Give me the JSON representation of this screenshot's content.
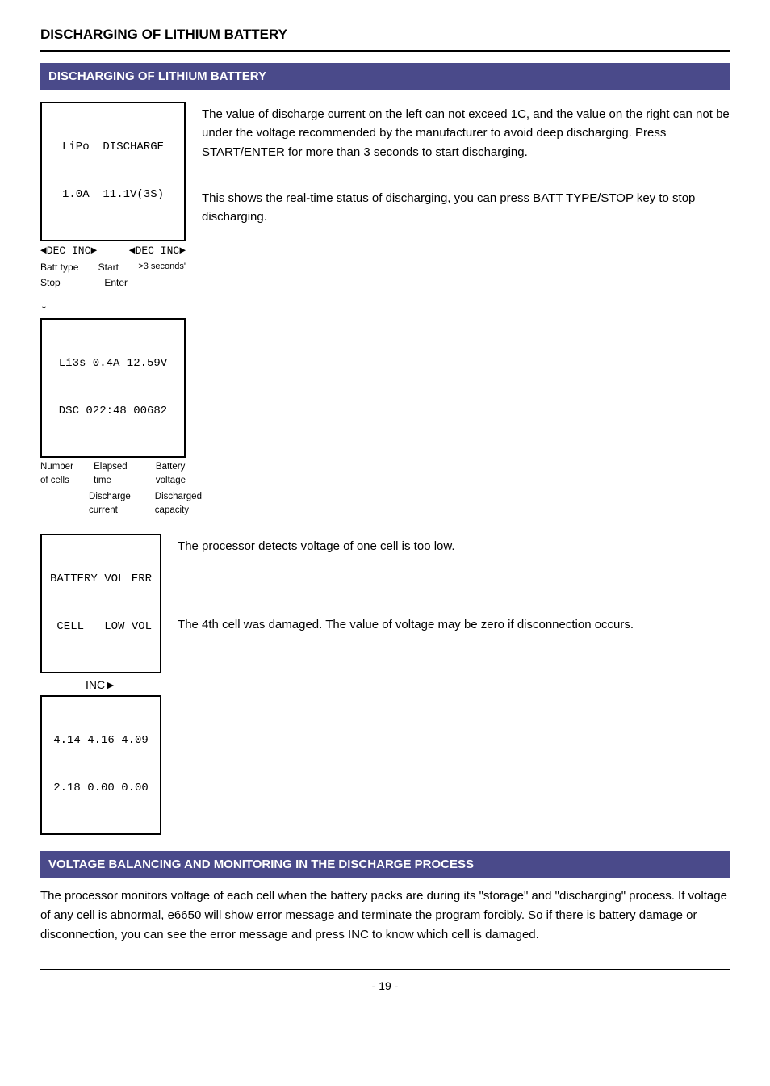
{
  "page": {
    "title": "DISCHARGING OF LITHIUM BATTERY",
    "section1_header": "DISCHARGING OF LITHIUM BATTERY",
    "section2_header": "VOLTAGE BALANCING AND MONITORING IN THE DISCHARGE PROCESS",
    "page_number": "- 19 -"
  },
  "discharge_screen1": {
    "line1": "LiPo  DISCHARGE",
    "line2": "1.0A  11.1V(3S)"
  },
  "discharge_screen1_buttons": {
    "left": "◄DEC INC►",
    "right": "◄DEC INC►"
  },
  "discharge_labels1": {
    "batt_type": "Batt type",
    "start": "Start",
    "stop": "Stop",
    "enter": "Enter",
    "time": ">3 seconds'"
  },
  "discharge_screen2": {
    "line1": "Li3s 0.4A 12.59V",
    "line2": "DSC 022:48 00682"
  },
  "discharge_labels2": {
    "number_of_cells": "Number",
    "of_cells": "of cells",
    "elapsed_time": "Elapsed",
    "time": "time",
    "battery_voltage": "Battery",
    "voltage": "voltage",
    "discharge_current": "Discharge",
    "current": "current",
    "discharged_capacity": "Discharged",
    "capacity": "capacity"
  },
  "desc1": "The value of discharge current on the left can not exceed 1C, and the value on the right can not be under the voltage recommended by the manufacturer to avoid deep discharging. Press START/ENTER for more than 3 seconds to start discharging.",
  "desc2": "This shows the real-time status of discharging, you can press BATT TYPE/STOP key to stop discharging.",
  "error_screen": {
    "line1": "BATTERY VOL ERR",
    "line2": " CELL   LOW VOL"
  },
  "inc_label": "INC►",
  "cell_voltage_screen": {
    "line1": "4.14 4.16 4.09",
    "line2": "2.18 0.00 0.00"
  },
  "desc3": "The processor detects voltage of one cell is too low.",
  "desc4": "The 4th cell was damaged. The value of voltage may be zero if disconnection occurs.",
  "bottom_paragraph": "The processor monitors voltage of each cell when the battery packs are during its \"storage\" and \"discharging\" process. If voltage of any cell is abnormal, e6650 will show error message and terminate the program forcibly. So if there is battery damage or disconnection, you can see the error message and press INC to know which cell is damaged."
}
